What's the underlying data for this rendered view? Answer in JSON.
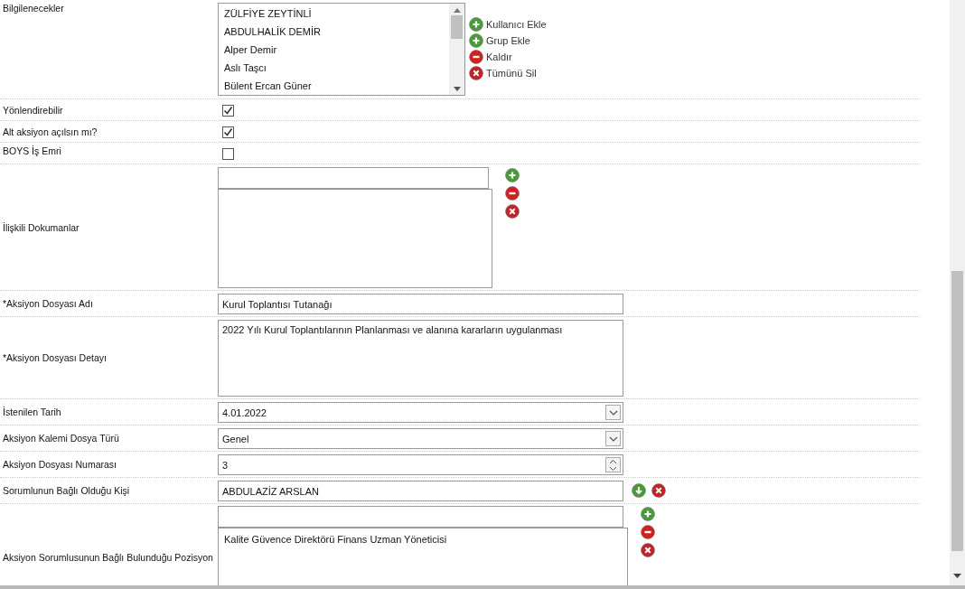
{
  "rows": [
    {
      "kind": "listbox",
      "label": "Bilgilenecekler",
      "items": [
        "ZÜLFİYE ZEYTİNLİ",
        "ABDULHALİK DEMİR",
        "Alper Demir",
        "Aslı Taşcı",
        "Bülent Ercan Güner"
      ],
      "actions": [
        {
          "kind": "add",
          "label": "Kullanıcı Ekle"
        },
        {
          "kind": "add",
          "label": "Grup Ekle"
        },
        {
          "kind": "remove",
          "label": "Kaldır"
        },
        {
          "kind": "clear",
          "label": "Tümünü Sil"
        }
      ]
    },
    {
      "kind": "checkbox",
      "label": "Yönlendirebilir",
      "checked": true
    },
    {
      "kind": "checkbox",
      "label": "Alt aksiyon açılsın mı?",
      "checked": true
    },
    {
      "kind": "checkbox",
      "label": "BOYS İş Emri",
      "checked": false
    },
    {
      "kind": "picker",
      "label": "İlişkili Dokumanlar",
      "items": [],
      "actions": [
        {
          "kind": "add"
        },
        {
          "kind": "remove"
        },
        {
          "kind": "clear"
        }
      ]
    },
    {
      "kind": "text",
      "label": "*Aksiyon Dosyası Adı",
      "value": "Kurul Toplantısı Tutanağı"
    },
    {
      "kind": "textarea",
      "label": "*Aksiyon Dosyası Detayı",
      "value": "2022 Yılı Kurul Toplantılarının Planlanması ve alanına kararların uygulanması"
    },
    {
      "kind": "dropdown",
      "label": "İstenilen Tarih",
      "value": "4.01.2022"
    },
    {
      "kind": "dropdown",
      "label": "Aksiyon Kalemi Dosya Türü",
      "value": "Genel"
    },
    {
      "kind": "number",
      "label": "Aksiyon Dosyası Numarası",
      "value": "3"
    },
    {
      "kind": "person",
      "label": "Sorumlunun Bağlı Olduğu Kişi",
      "value": "ABDULAZİZ ARSLAN",
      "actions": [
        {
          "kind": "select"
        },
        {
          "kind": "clear"
        }
      ]
    },
    {
      "kind": "picker",
      "label": "Aksiyon Sorumlusunun Bağlı Bulunduğu Pozisyon",
      "items": [
        "Kalite Güvence Direktörü Finans Uzman Yöneticisi"
      ],
      "actions": [
        {
          "kind": "add"
        },
        {
          "kind": "remove"
        },
        {
          "kind": "clear"
        }
      ]
    }
  ]
}
